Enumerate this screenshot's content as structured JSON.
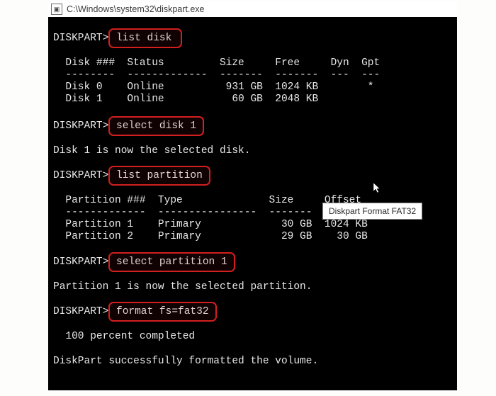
{
  "window": {
    "title": "C:\\Windows\\system32\\diskpart.exe"
  },
  "tooltip": "Diskpart Format FAT32",
  "prompts": {
    "p": "DISKPART>"
  },
  "commands": {
    "c1": "list disk",
    "c2": "select disk 1",
    "c3": "list partition",
    "c4": "select partition 1",
    "c5": "format fs=fat32"
  },
  "outputs": {
    "disk_header": "  Disk ###  Status         Size     Free     Dyn  Gpt",
    "disk_divider": "  --------  -------------  -------  -------  ---  ---",
    "disk_row0": "  Disk 0    Online          931 GB  1024 KB        *",
    "disk_row1": "  Disk 1    Online           60 GB  2048 KB",
    "sel_disk": "Disk 1 is now the selected disk.",
    "part_header": "  Partition ###  Type              Size     Offset",
    "part_divider": "  -------------  ----------------  -------  -------",
    "part_row1": "  Partition 1    Primary             30 GB  1024 KB",
    "part_row2": "  Partition 2    Primary             29 GB    30 GB",
    "sel_part": "Partition 1 is now the selected partition.",
    "progress": "  100 percent completed",
    "done": "DiskPart successfully formatted the volume."
  }
}
